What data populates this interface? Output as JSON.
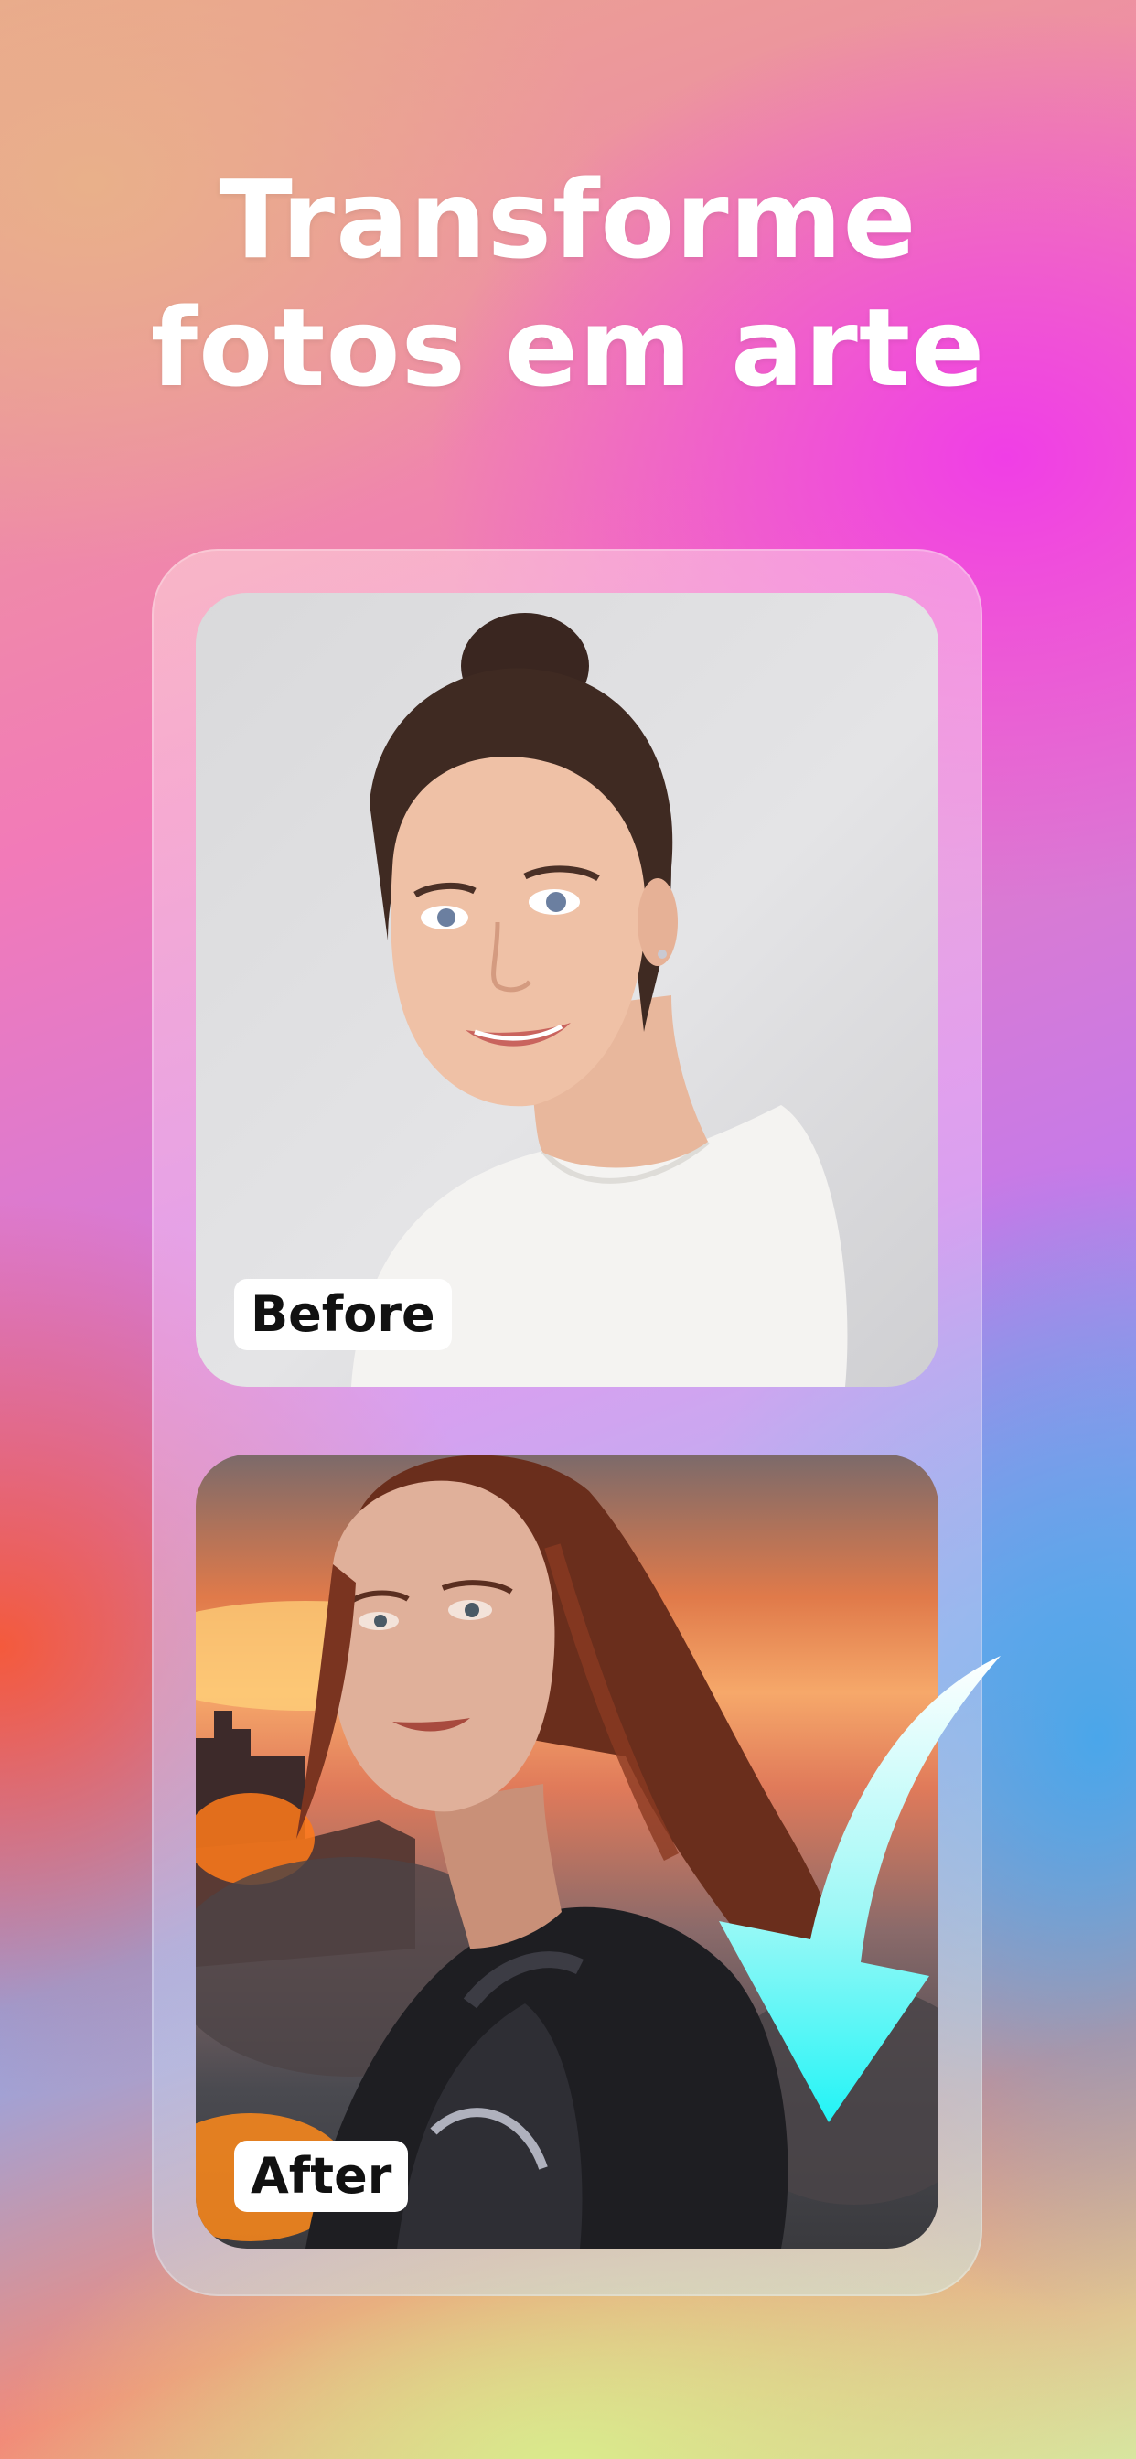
{
  "headline": {
    "line1": "Transforme",
    "line2": "fotos em arte"
  },
  "comparison": {
    "before_label": "Before",
    "after_label": "After"
  },
  "icons": {
    "arrow": "curved-arrow-down-icon"
  },
  "colors": {
    "arrow_top": "#ffffff",
    "arrow_bottom": "#22f4f6",
    "label_bg": "#ffffff",
    "label_text": "#111111",
    "headline_text": "#ffffff"
  }
}
